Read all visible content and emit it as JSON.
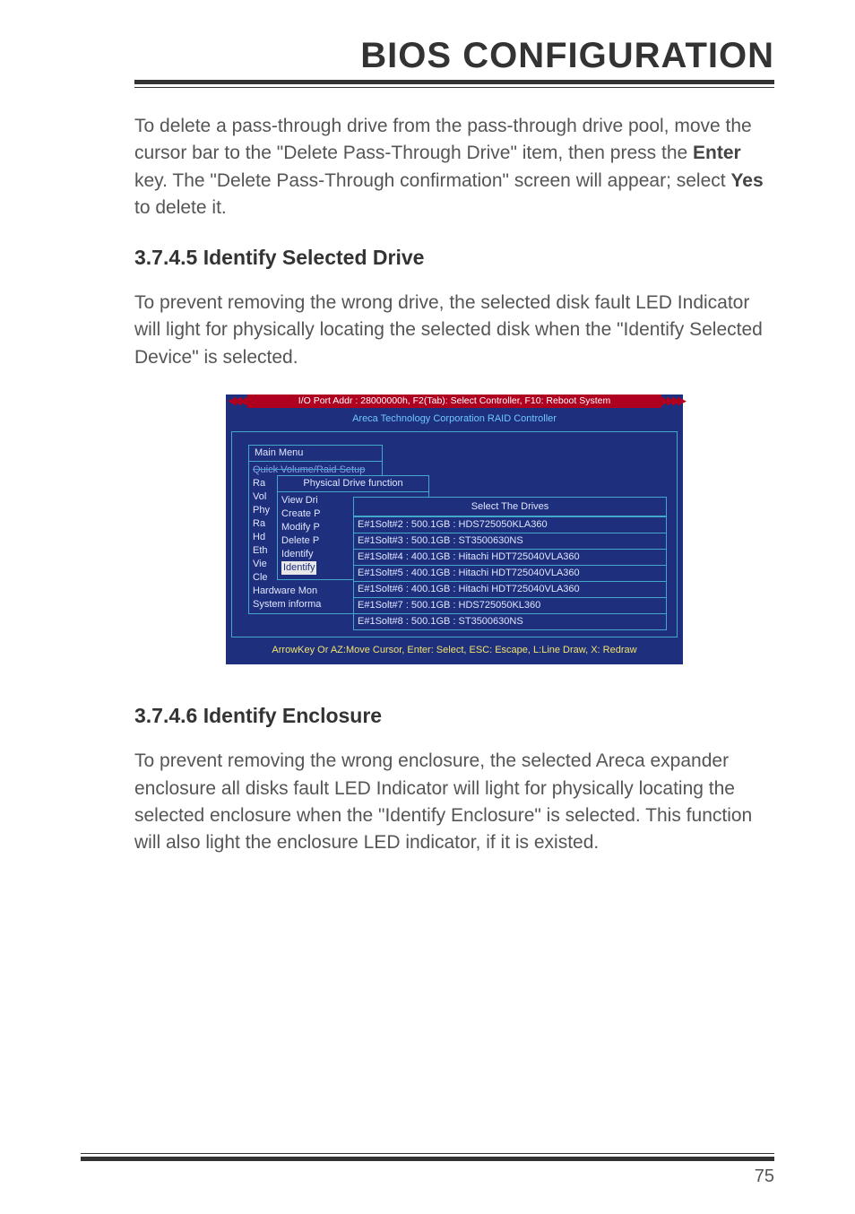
{
  "header": {
    "title": "BIOS CONFIGURATION"
  },
  "para1_a": "To delete a pass-through drive from the pass-through drive pool, move the cursor bar to the \"Delete Pass-Through Drive\" item, then press the ",
  "para1_bold1": "Enter",
  "para1_b": " key. The \"Delete Pass-Through confirmation\" screen will appear; select ",
  "para1_bold2": "Yes",
  "para1_c": " to delete it.",
  "sec1": {
    "heading": "3.7.4.5 Identify Selected Drive"
  },
  "para2": "To prevent removing the wrong drive, the selected disk fault LED Indicator will light for physically locating the selected disk when the \"Identify Selected Device\" is selected.",
  "bios": {
    "topbar": "I/O Port Addr : 28000000h, F2(Tab): Select Controller, F10: Reboot System",
    "subtitle": "Areca Technology Corporation RAID Controller",
    "main_menu_title": "Main Menu",
    "main_menu_items": {
      "quick": "Quick Volume/Raid Setup",
      "ra1": "Ra",
      "vol": "Vol",
      "phy": "Phy",
      "ra2": "Ra",
      "hd": "Hd",
      "eth": "Eth",
      "vie": "Vie",
      "cle": "Cle",
      "hwmon": "Hardware Mon",
      "sysinfo": "System informa"
    },
    "pdfunc_title": "Physical Drive function",
    "pdfunc_items": {
      "view": "View Dri",
      "create": "Create P",
      "modify": "Modify P",
      "delete": "Delete P",
      "identify1": "Identify",
      "identify2": "Identify"
    },
    "drives_title": "Select The Drives",
    "drives": [
      "E#1Solt#2 : 500.1GB : HDS725050KLA360",
      "E#1Solt#3 : 500.1GB : ST3500630NS",
      "E#1Solt#4 : 400.1GB : Hitachi HDT725040VLA360",
      "E#1Solt#5 : 400.1GB : Hitachi HDT725040VLA360",
      "E#1Solt#6 : 400.1GB : Hitachi HDT725040VLA360",
      "E#1Solt#7 : 500.1GB : HDS725050KL360",
      "E#1Solt#8 : 500.1GB : ST3500630NS"
    ],
    "footer": "ArrowKey Or AZ:Move Cursor, Enter: Select, ESC: Escape, L:Line Draw, X: Redraw"
  },
  "sec2": {
    "heading": "3.7.4.6 Identify Enclosure"
  },
  "para3": "To prevent removing the wrong enclosure, the selected Areca expander enclosure all disks fault LED Indicator will light for physically locating the selected enclosure when the \"Identify Enclosure\" is selected. This function will also light the enclosure LED indicator, if it is existed.",
  "page_number": "75"
}
